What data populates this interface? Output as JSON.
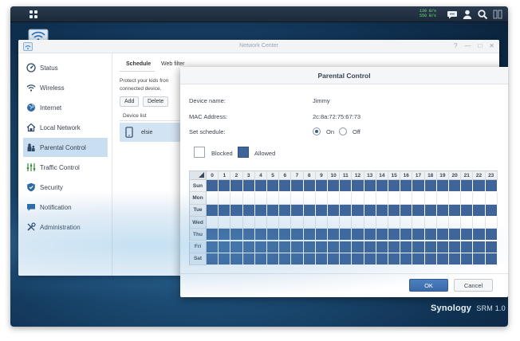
{
  "taskbar": {
    "upload_speed": "130 B/s",
    "download_speed": "550 B/s",
    "icons": [
      "main-menu-icon",
      "chat-icon",
      "user-icon",
      "search-icon",
      "widgets-icon"
    ]
  },
  "network_center": {
    "title": "Network Center",
    "sidebar": {
      "items": [
        {
          "label": "Status",
          "icon": "status-icon"
        },
        {
          "label": "Wireless",
          "icon": "wifi-icon"
        },
        {
          "label": "Internet",
          "icon": "globe-icon"
        },
        {
          "label": "Local Network",
          "icon": "home-network-icon"
        },
        {
          "label": "Parental Control",
          "icon": "parental-control-icon"
        },
        {
          "label": "Traffic Control",
          "icon": "traffic-control-icon"
        },
        {
          "label": "Security",
          "icon": "shield-icon"
        },
        {
          "label": "Notification",
          "icon": "chat-bubble-icon"
        },
        {
          "label": "Administration",
          "icon": "tools-icon"
        }
      ],
      "active_index": 4
    },
    "tabs": {
      "schedule": "Schedule",
      "web_filter": "Web filter"
    },
    "description": {
      "line1": "Protect your kids fron",
      "line2": "connected device."
    },
    "buttons": {
      "add": "Add",
      "delete": "Delete"
    },
    "device_list": {
      "header": "Device list",
      "rows": [
        {
          "name": "elsie"
        }
      ]
    }
  },
  "parental_control": {
    "title": "Parental Control",
    "device_name_label": "Device name:",
    "device_name": "Jimmy",
    "mac_label": "MAC Address:",
    "mac": "2c:8a:72:75:67:73",
    "schedule_label": "Set schedule:",
    "schedule_on_label": "On",
    "schedule_off_label": "Off",
    "schedule_on": true,
    "legend": {
      "blocked": "Blocked",
      "allowed": "Allowed"
    },
    "colors": {
      "allowed": "#3e6499",
      "blocked": "#ffffff"
    },
    "hours": [
      "0",
      "1",
      "2",
      "3",
      "4",
      "5",
      "6",
      "7",
      "8",
      "9",
      "10",
      "11",
      "12",
      "13",
      "14",
      "15",
      "16",
      "17",
      "18",
      "19",
      "20",
      "21",
      "22",
      "23"
    ],
    "days": [
      {
        "label": "Sun",
        "allowed": true
      },
      {
        "label": "Mon",
        "allowed": false
      },
      {
        "label": "Tue",
        "allowed": true
      },
      {
        "label": "Wed",
        "allowed": false
      },
      {
        "label": "Thu",
        "allowed": true
      },
      {
        "label": "Fri",
        "allowed": true
      },
      {
        "label": "Sat",
        "allowed": true
      }
    ],
    "ok_label": "OK",
    "cancel_label": "Cancel"
  },
  "branding": {
    "brand": "Synology",
    "product": "SRM",
    "version": "1.0"
  }
}
